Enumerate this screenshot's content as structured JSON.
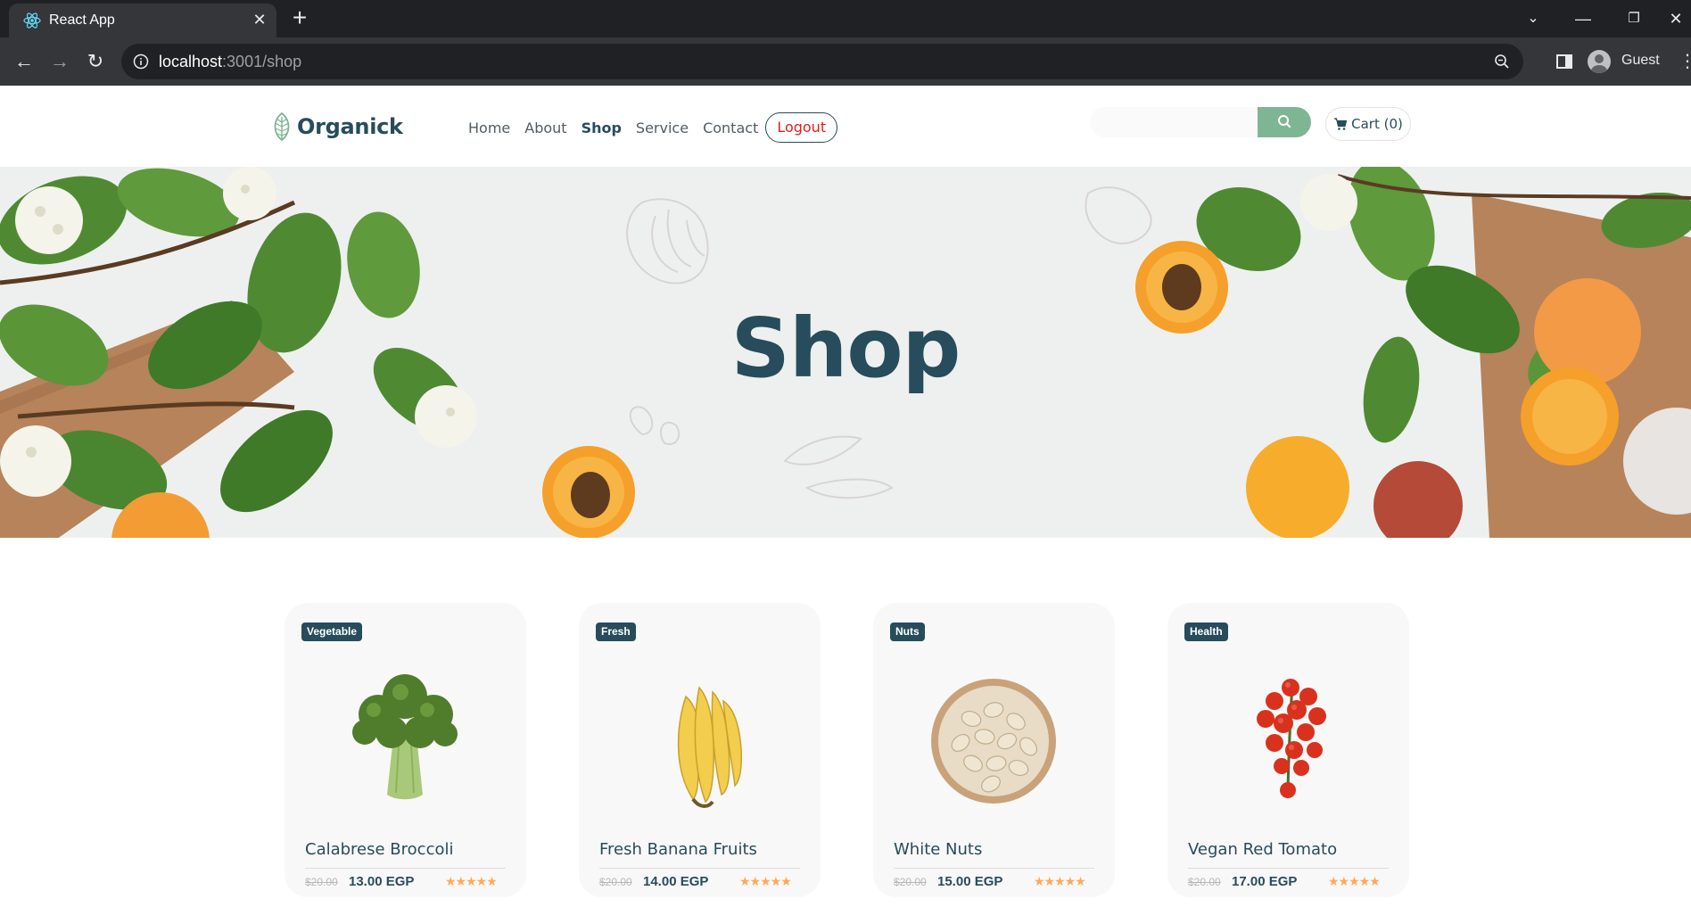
{
  "browser": {
    "tab_title": "React App",
    "url_host": "localhost",
    "url_path": ":3001/shop",
    "profile_label": "Guest"
  },
  "site": {
    "logo_text": "Organick",
    "nav": [
      "Home",
      "About",
      "Shop",
      "Service",
      "Contact"
    ],
    "active_nav": "Shop",
    "logout_label": "Logout",
    "search_placeholder": "",
    "cart_label": "Cart (0)"
  },
  "hero": {
    "title": "Shop"
  },
  "products": [
    {
      "badge": "Vegetable",
      "name": "Calabrese Broccoli",
      "old_price": "$20.00",
      "price": "13.00 EGP",
      "rating": 5,
      "image": "broccoli"
    },
    {
      "badge": "Fresh",
      "name": "Fresh Banana Fruits",
      "old_price": "$20.00",
      "price": "14.00 EGP",
      "rating": 5,
      "image": "banana"
    },
    {
      "badge": "Nuts",
      "name": "White Nuts",
      "old_price": "$20.00",
      "price": "15.00 EGP",
      "rating": 5,
      "image": "nuts"
    },
    {
      "badge": "Health",
      "name": "Vegan Red Tomato",
      "old_price": "$20.00",
      "price": "17.00 EGP",
      "rating": 5,
      "image": "tomato"
    }
  ],
  "colors": {
    "brand": "#274c5b",
    "accent": "#7eb693",
    "star": "#ffa858",
    "logout": "#e21d1d"
  }
}
